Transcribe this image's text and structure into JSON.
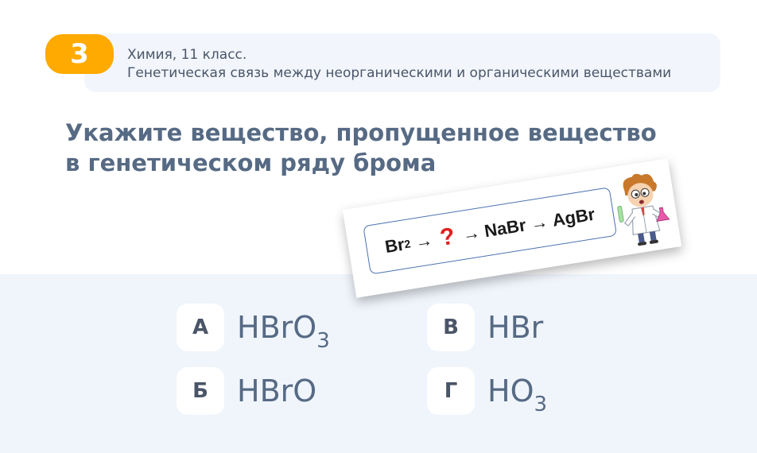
{
  "header": {
    "number": "3",
    "subject": "Химия, 11 класс.",
    "topic": "Генетическая связь между неорганическими и органическими веществами"
  },
  "question": "Укажите вещество, пропущенное вещество в генетическом ряду брома",
  "chain": {
    "start": "Br",
    "start_sub": "2",
    "arrow": "→",
    "missing": "?",
    "step2": "NaBr",
    "step3": "AgBr"
  },
  "options": [
    {
      "key": "А",
      "formula": "HBrO",
      "sub": "3"
    },
    {
      "key": "В",
      "formula": "HBr",
      "sub": ""
    },
    {
      "key": "Б",
      "formula": "HBrO",
      "sub": ""
    },
    {
      "key": "Г",
      "formula": "HO",
      "sub": "3"
    }
  ],
  "colors": {
    "badge": "#ffaa00",
    "accent_text": "#566a84",
    "panel_bg": "#f0f5fc",
    "missing_mark": "#e02020"
  }
}
